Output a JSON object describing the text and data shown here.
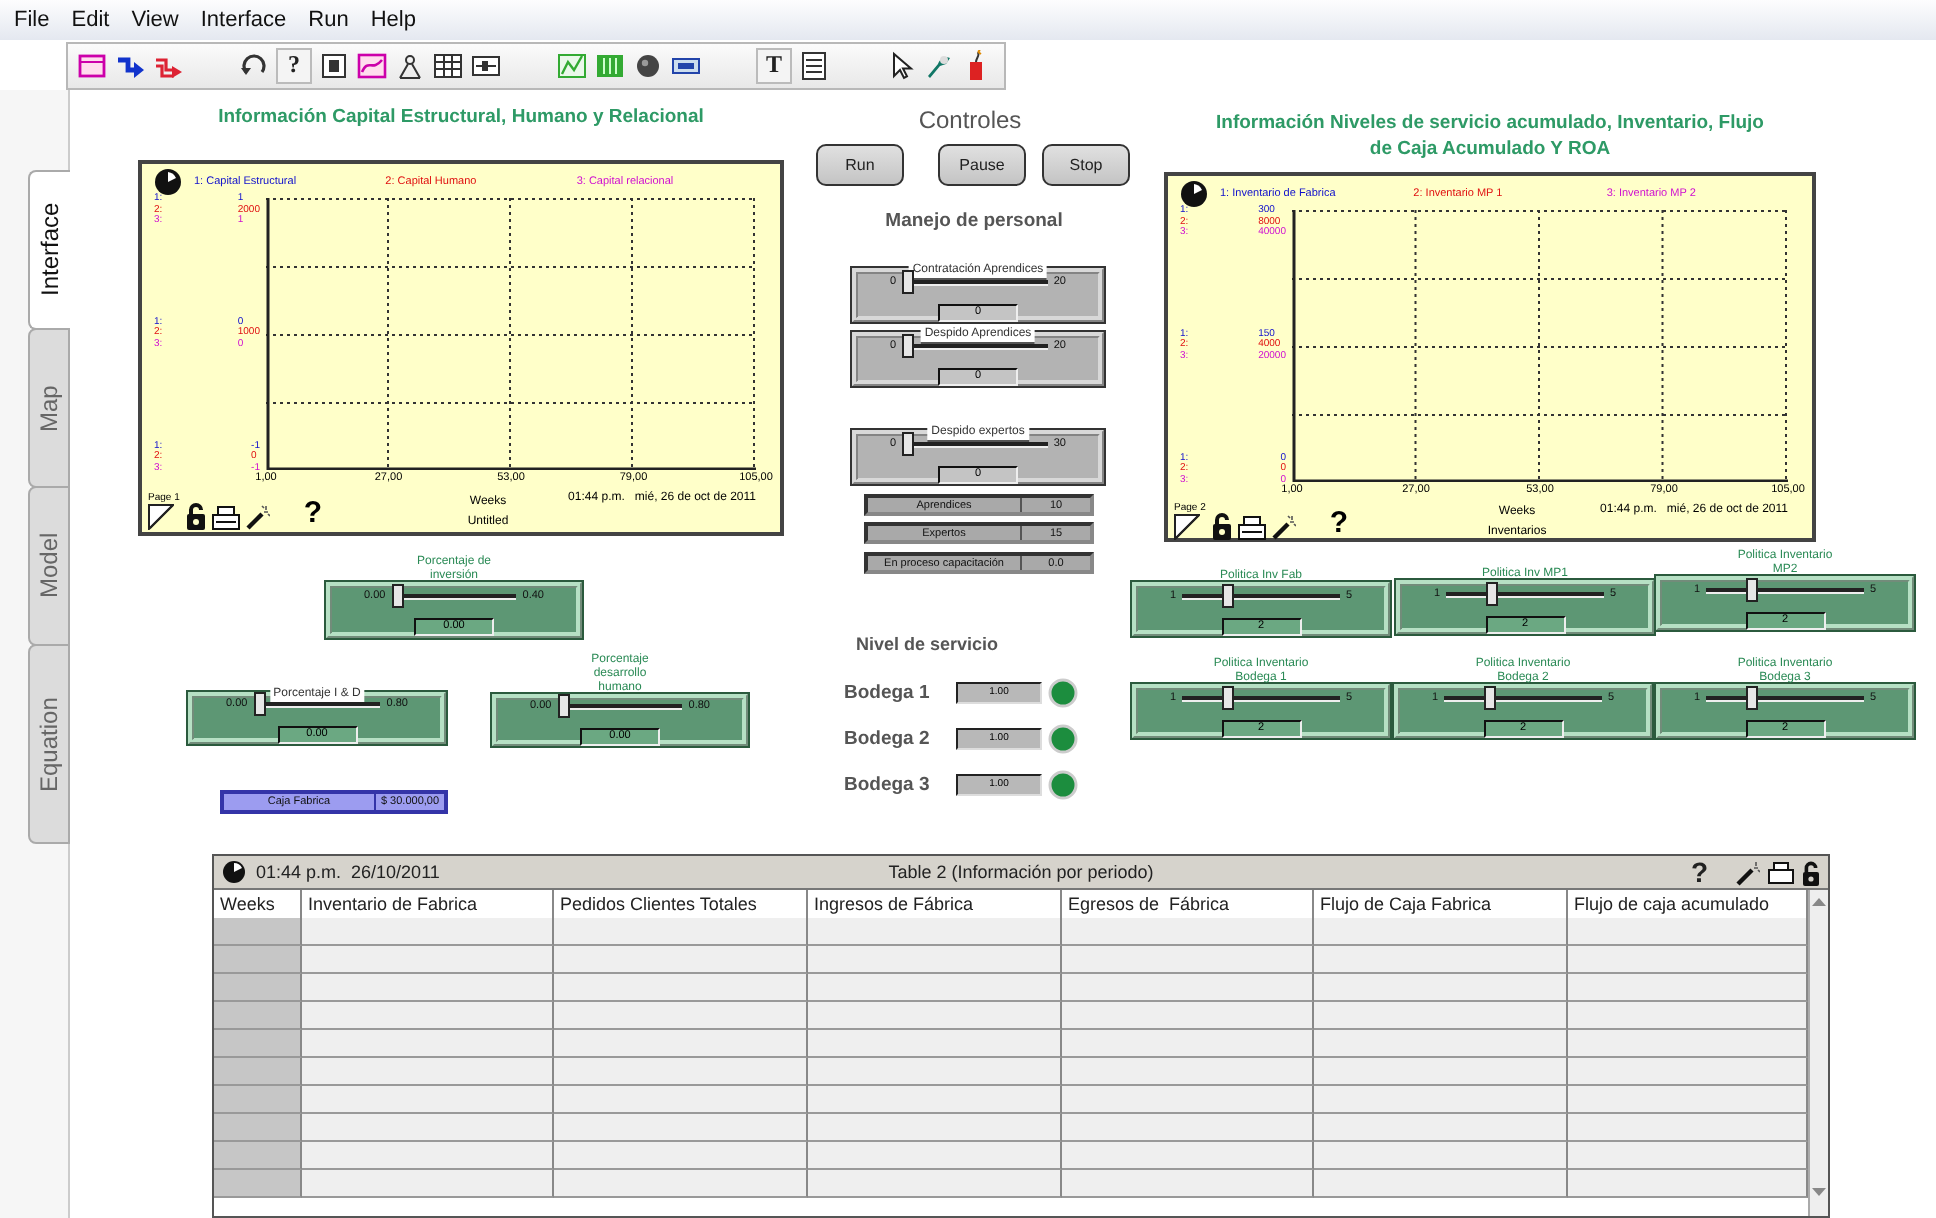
{
  "menu": [
    "File",
    "Edit",
    "View",
    "Interface",
    "Run",
    "Help"
  ],
  "toolbar_glyphs": [
    "?",
    "T"
  ],
  "side_tabs": [
    {
      "label": "Interface",
      "selected": true
    },
    {
      "label": "Map",
      "selected": false
    },
    {
      "label": "Model",
      "selected": false
    },
    {
      "label": "Equation",
      "selected": false
    }
  ],
  "graphs": [
    {
      "title": "Información Capital Estructural, Humano y Relacional",
      "series": [
        {
          "label": "1: Capital Estructural",
          "color": "#1010cc"
        },
        {
          "label": "2: Capital Humano",
          "color": "#e01010"
        },
        {
          "label": "3: Capital relacional",
          "color": "#d010d0"
        }
      ],
      "levels": [
        [
          {
            "mark": "1:",
            "value": "1"
          },
          {
            "mark": "2:",
            "value": "2000"
          },
          {
            "mark": "3:",
            "value": "1"
          }
        ],
        [
          {
            "mark": "1:",
            "value": "0"
          },
          {
            "mark": "2:",
            "value": "1000"
          },
          {
            "mark": "3:",
            "value": "0"
          }
        ],
        [
          {
            "mark": "1:",
            "value": "-1"
          },
          {
            "mark": "2:",
            "value": "0"
          },
          {
            "mark": "3:",
            "value": "-1"
          }
        ]
      ],
      "x_ticks": [
        "1,00",
        "27,00",
        "53,00",
        "79,00",
        "105,00"
      ],
      "page": "Page 1",
      "help": "?",
      "x_label": "Weeks",
      "name": "Untitled",
      "timestamp": "01:44 p.m.   mié, 26 de oct de 2011"
    },
    {
      "title": "Información Niveles de servicio acumulado, Inventario, Flujo de Caja Acumulado Y ROA",
      "series": [
        {
          "label": "1: Inventario de Fabrica",
          "color": "#1010cc"
        },
        {
          "label": "2: Inventario MP 1",
          "color": "#e01010"
        },
        {
          "label": "3: Inventario MP 2",
          "color": "#d010d0"
        }
      ],
      "levels": [
        [
          {
            "mark": "1:",
            "value": "300"
          },
          {
            "mark": "2:",
            "value": "8000"
          },
          {
            "mark": "3:",
            "value": "40000"
          }
        ],
        [
          {
            "mark": "1:",
            "value": "150"
          },
          {
            "mark": "2:",
            "value": "4000"
          },
          {
            "mark": "3:",
            "value": "20000"
          }
        ],
        [
          {
            "mark": "1:",
            "value": "0"
          },
          {
            "mark": "2:",
            "value": "0"
          },
          {
            "mark": "3:",
            "value": "0"
          }
        ]
      ],
      "x_ticks": [
        "1,00",
        "27,00",
        "53,00",
        "79,00",
        "105,00"
      ],
      "page": "Page 2",
      "help": "?",
      "x_label": "Weeks",
      "name": "Inventarios",
      "timestamp": "01:44 p.m.   mié, 26 de oct de 2011"
    }
  ],
  "controls": {
    "title": "Controles",
    "buttons": [
      "Run",
      "Pause",
      "Stop"
    ]
  },
  "staff": {
    "title": "Manejo de personal",
    "sliders": [
      {
        "kind": "grey",
        "label": "Contratación Aprendices",
        "min": "0",
        "max": "20",
        "value": "0",
        "level": 0
      },
      {
        "kind": "grey",
        "label": "Despido Aprendices",
        "min": "0",
        "max": "20",
        "value": "0",
        "level": 0
      },
      {
        "kind": "grey",
        "label": "Despido expertos",
        "min": "0",
        "max": "30",
        "value": "0",
        "level": 0
      }
    ],
    "stats": [
      {
        "label": "Aprendices",
        "value": "10"
      },
      {
        "label": "Expertos",
        "value": "15"
      },
      {
        "label": "En proceso capacitación",
        "value": "0.0"
      }
    ]
  },
  "investment_sliders": [
    {
      "kind": "green",
      "label": "Porcentaje de inversión",
      "min": "0.00",
      "max": "0.40",
      "value": "0.00",
      "level": 0
    },
    {
      "kind": "green",
      "label": "Porcentaje I & D",
      "min": "0.00",
      "max": "0.80",
      "value": "0.00",
      "level": 0
    },
    {
      "kind": "green",
      "label": "Porcentaje desarrollo humano",
      "min": "0.00",
      "max": "0.80",
      "value": "0.00",
      "level": 0
    }
  ],
  "cash": {
    "label": "Caja Fabrica",
    "value": "$ 30.000,00"
  },
  "service": {
    "title": "Nivel de servicio",
    "warehouses": [
      {
        "label": "Bodega 1",
        "value": "1.00",
        "lit": true
      },
      {
        "label": "Bodega 2",
        "value": "1.00",
        "lit": true
      },
      {
        "label": "Bodega 3",
        "value": "1.00",
        "lit": true
      }
    ]
  },
  "policy_sliders": [
    {
      "kind": "green",
      "label": "Politica Inv Fab",
      "min": "1",
      "max": "5",
      "value": "2",
      "level": 0.25
    },
    {
      "kind": "green",
      "label": "Politica Inv MP1",
      "min": "1",
      "max": "5",
      "value": "2",
      "level": 0.25
    },
    {
      "kind": "green",
      "label": "Politica Inventario MP2",
      "min": "1",
      "max": "5",
      "value": "2",
      "level": 0.25
    },
    {
      "kind": "green",
      "label": "Politica Inventario Bodega 1",
      "min": "1",
      "max": "5",
      "value": "2",
      "level": 0.25
    },
    {
      "kind": "green",
      "label": "Politica Inventario Bodega 2",
      "min": "1",
      "max": "5",
      "value": "2",
      "level": 0.25
    },
    {
      "kind": "green",
      "label": "Politica Inventario Bodega 3",
      "min": "1",
      "max": "5",
      "value": "2",
      "level": 0.25
    }
  ],
  "table": {
    "time": "01:44 p.m.",
    "date": "26/10/2011",
    "title": "Table 2 (Información por periodo)",
    "help": "?",
    "columns": [
      "Weeks",
      "Inventario de Fabrica",
      "Pedidos Clientes Totales",
      "Ingresos de Fábrica",
      "Egresos de  Fábrica",
      "Flujo de Caja Fabrica",
      "Flujo de caja acumulado"
    ]
  }
}
